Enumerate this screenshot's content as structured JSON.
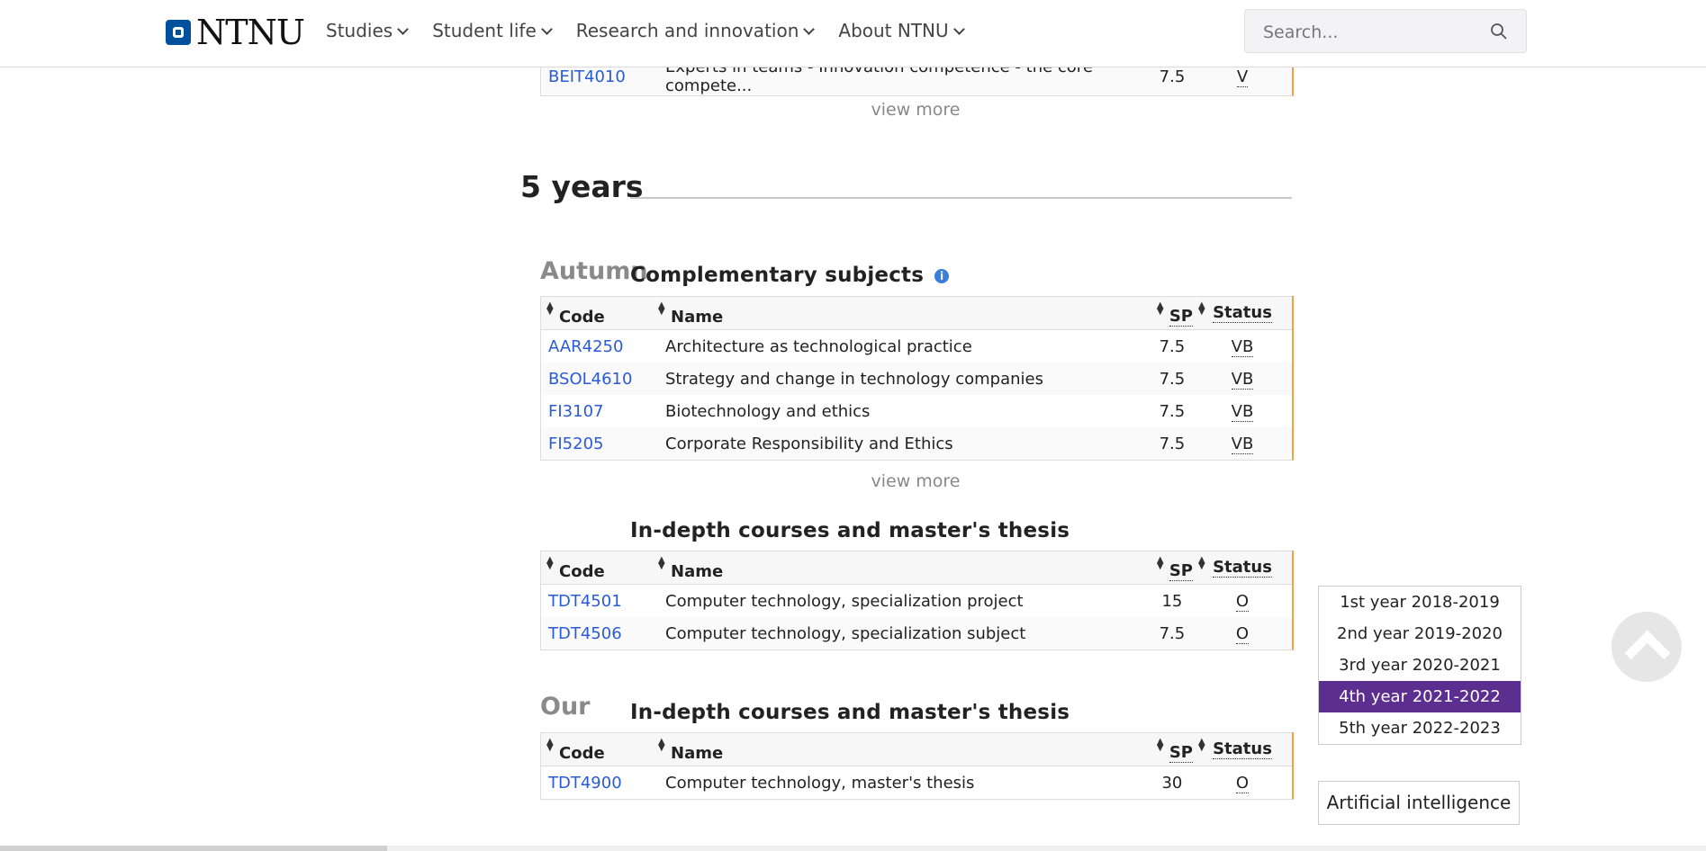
{
  "header": {
    "logo_text": "NTNU",
    "nav": [
      "Studies",
      "Student life",
      "Research and innovation",
      "About NTNU"
    ],
    "search_placeholder": "Search..."
  },
  "top_partial_row": {
    "code": "BEIT4010",
    "name": "Experts in teams - Innovation competence - the core compete...",
    "sp": "7.5",
    "status": "V"
  },
  "view_more_label": "view more",
  "section": {
    "heading": "5 years"
  },
  "table_headers": {
    "code": "Code",
    "name": "Name",
    "sp": "SP",
    "status": "Status"
  },
  "autumn": {
    "term_label": "Autumn",
    "complementary": {
      "title": "Complementary subjects",
      "rows": [
        {
          "code": "AAR4250",
          "name": "Architecture as technological practice",
          "sp": "7.5",
          "status": "VB"
        },
        {
          "code": "BSOL4610",
          "name": "Strategy and change in technology companies",
          "sp": "7.5",
          "status": "VB"
        },
        {
          "code": "FI3107",
          "name": "Biotechnology and ethics",
          "sp": "7.5",
          "status": "VB"
        },
        {
          "code": "FI5205",
          "name": "Corporate Responsibility and Ethics",
          "sp": "7.5",
          "status": "VB"
        }
      ]
    },
    "indepth": {
      "title": "In-depth courses and master's thesis",
      "rows": [
        {
          "code": "TDT4501",
          "name": "Computer technology, specialization project",
          "sp": "15",
          "status": "O"
        },
        {
          "code": "TDT4506",
          "name": "Computer technology, specialization subject",
          "sp": "7.5",
          "status": "O"
        }
      ]
    }
  },
  "spring": {
    "term_label": "Our",
    "indepth": {
      "title": "In-depth courses and master's thesis",
      "rows": [
        {
          "code": "TDT4900",
          "name": "Computer technology, master's thesis",
          "sp": "30",
          "status": "O"
        }
      ]
    }
  },
  "year_nav": {
    "items": [
      "1st year 2018-2019",
      "2nd year 2019-2020",
      "3rd year 2020-2021",
      "4th year 2021-2022",
      "5th year 2022-2023"
    ],
    "active_index": 3
  },
  "specialization_button": "Artificial intelligence",
  "colors": {
    "accent_purple": "#5b2e8f",
    "link_blue": "#2a5bd7",
    "table_edge_orange": "#f3a046",
    "ntnu_blue": "#00509e"
  }
}
